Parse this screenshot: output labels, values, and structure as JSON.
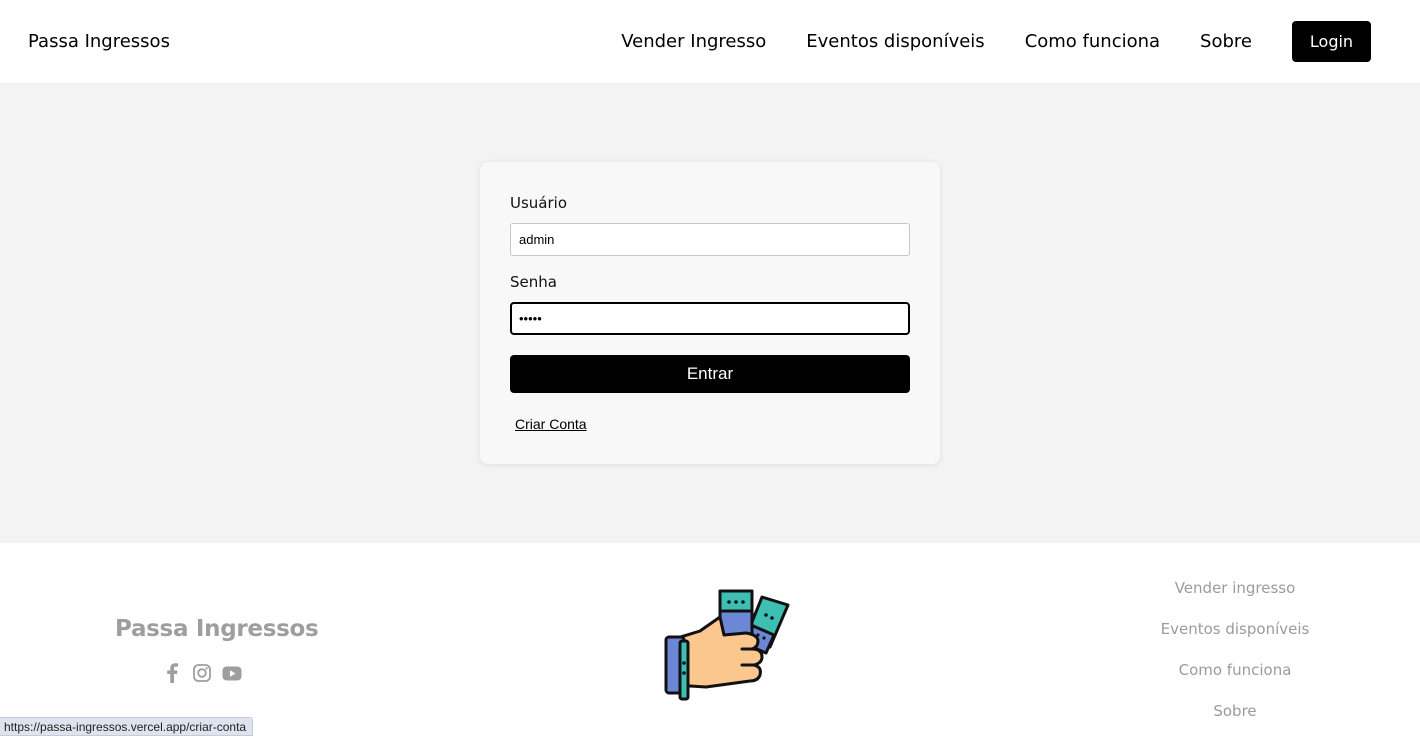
{
  "header": {
    "brand": "Passa Ingressos",
    "nav": [
      "Vender Ingresso",
      "Eventos disponíveis",
      "Como funciona",
      "Sobre"
    ],
    "login_label": "Login"
  },
  "form": {
    "user_label": "Usuário",
    "user_value": "admin",
    "pass_label": "Senha",
    "pass_value": "•••••",
    "submit_label": "Entrar",
    "create_account": "Criar Conta"
  },
  "footer": {
    "brand": "Passa Ingressos",
    "social_icons": [
      "facebook-icon",
      "instagram-icon",
      "youtube-icon"
    ],
    "links": [
      "Vender ingresso",
      "Eventos disponíveis",
      "Como funciona",
      "Sobre"
    ]
  },
  "status_url": "https://passa-ingressos.vercel.app/criar-conta",
  "colors": {
    "accent": "#000000",
    "page_bg": "#f3f3f3",
    "card_bg": "#f8f8f8",
    "footer_text": "#9e9e9e",
    "ticket_teal": "#3dbfb4",
    "ticket_blue": "#6b87d6",
    "hand_skin": "#fcc68f"
  }
}
